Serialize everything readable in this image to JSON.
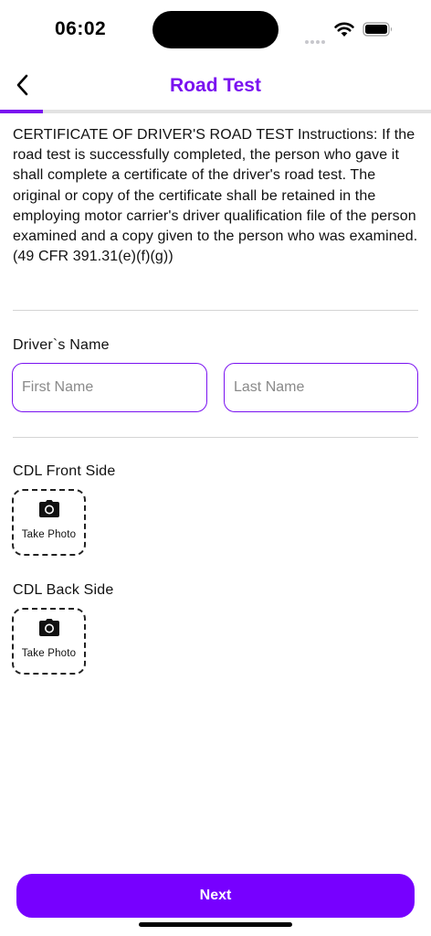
{
  "status_bar": {
    "time": "06:02",
    "icons": [
      "cellular-signal-icon",
      "wifi-icon",
      "battery-icon"
    ]
  },
  "header": {
    "title": "Road Test",
    "back_icon": "chevron-left-icon",
    "step_progress_fraction": 0.1
  },
  "instructions": {
    "text": "CERTIFICATE OF DRIVER'S ROAD TEST Instructions: If the road test is successfully completed, the person who gave it shall complete a certificate of the driver's road test. The original or copy of the certificate shall be retained in the employing motor carrier's driver qualification file of the person examined and a copy given to the person who was examined. (49 CFR 391.31(e)(f)(g))"
  },
  "driver_name": {
    "label": "Driver`s Name",
    "first_name": {
      "value": "",
      "placeholder": "First Name"
    },
    "last_name": {
      "value": "",
      "placeholder": "Last Name"
    }
  },
  "cdl_front": {
    "label": "CDL Front Side",
    "button_label": "Take Photo",
    "icon": "camera-icon"
  },
  "cdl_back": {
    "label": "CDL Back Side",
    "button_label": "Take Photo",
    "icon": "camera-icon"
  },
  "footer": {
    "next_label": "Next"
  },
  "colors": {
    "accent": "#7a12f0",
    "button": "#7700ff",
    "divider": "#d4d4d4",
    "progress_track": "#e2e2e2"
  }
}
